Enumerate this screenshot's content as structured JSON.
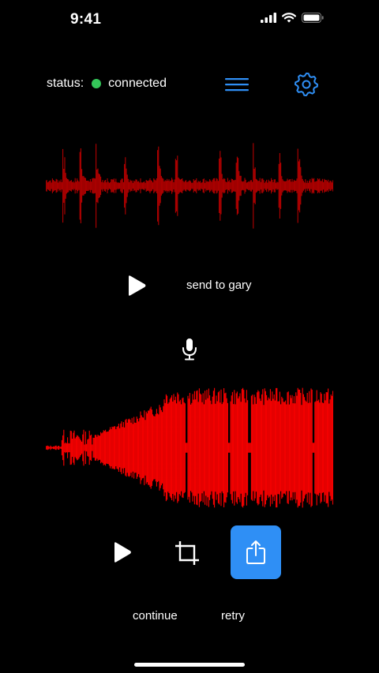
{
  "status_bar": {
    "time": "9:41"
  },
  "header": {
    "status_label": "status:",
    "status_value": "connected",
    "status_color": "#34c759",
    "menu_icon": "hamburger-menu-icon",
    "settings_icon": "gear-icon"
  },
  "colors": {
    "accent": "#2f8ff5",
    "wave_top": "#b30000",
    "wave_bottom": "#ff0000",
    "background": "#000000"
  },
  "received": {
    "play_icon": "play-icon",
    "send_label": "send to gary"
  },
  "recorder": {
    "mic_icon": "microphone-icon",
    "play_icon": "play-icon",
    "crop_icon": "crop-icon",
    "share_icon": "share-icon",
    "continue_label": "continue",
    "retry_label": "retry"
  }
}
